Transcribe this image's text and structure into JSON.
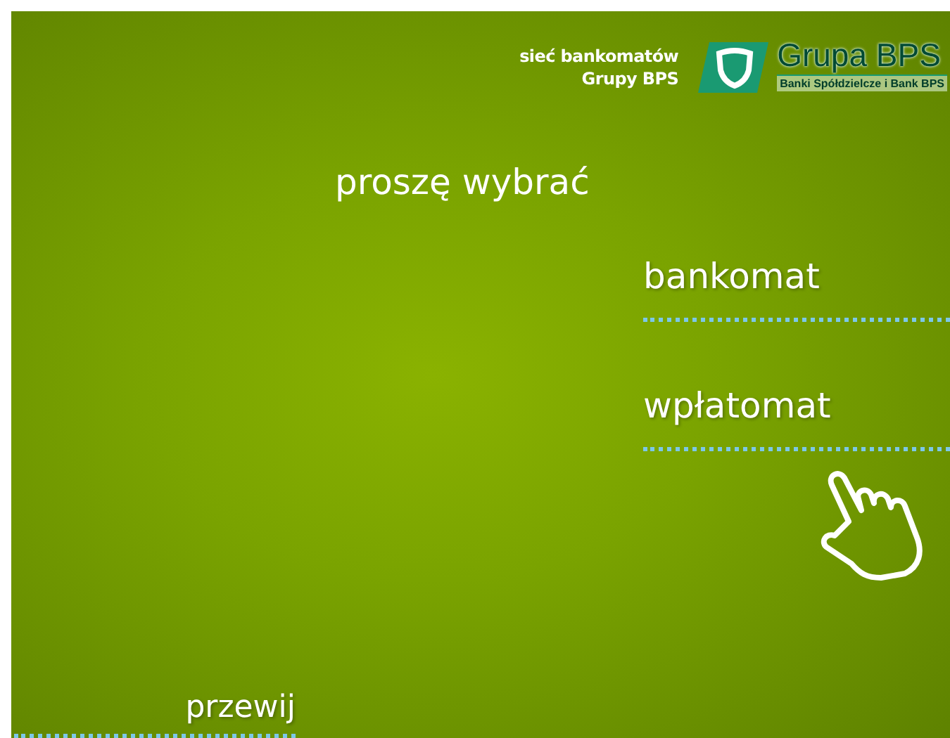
{
  "header": {
    "tagline": [
      "sieć bankomatów",
      "Grupy BPS"
    ],
    "logo": {
      "name": "Grupa BPS",
      "subtitle": "Banki Spółdzielcze i Bank BPS"
    }
  },
  "prompt": "proszę wybrać",
  "options": [
    {
      "label": "bankomat"
    },
    {
      "label": "wpłatomat"
    }
  ],
  "bottom_option": {
    "label": "przewij"
  }
}
